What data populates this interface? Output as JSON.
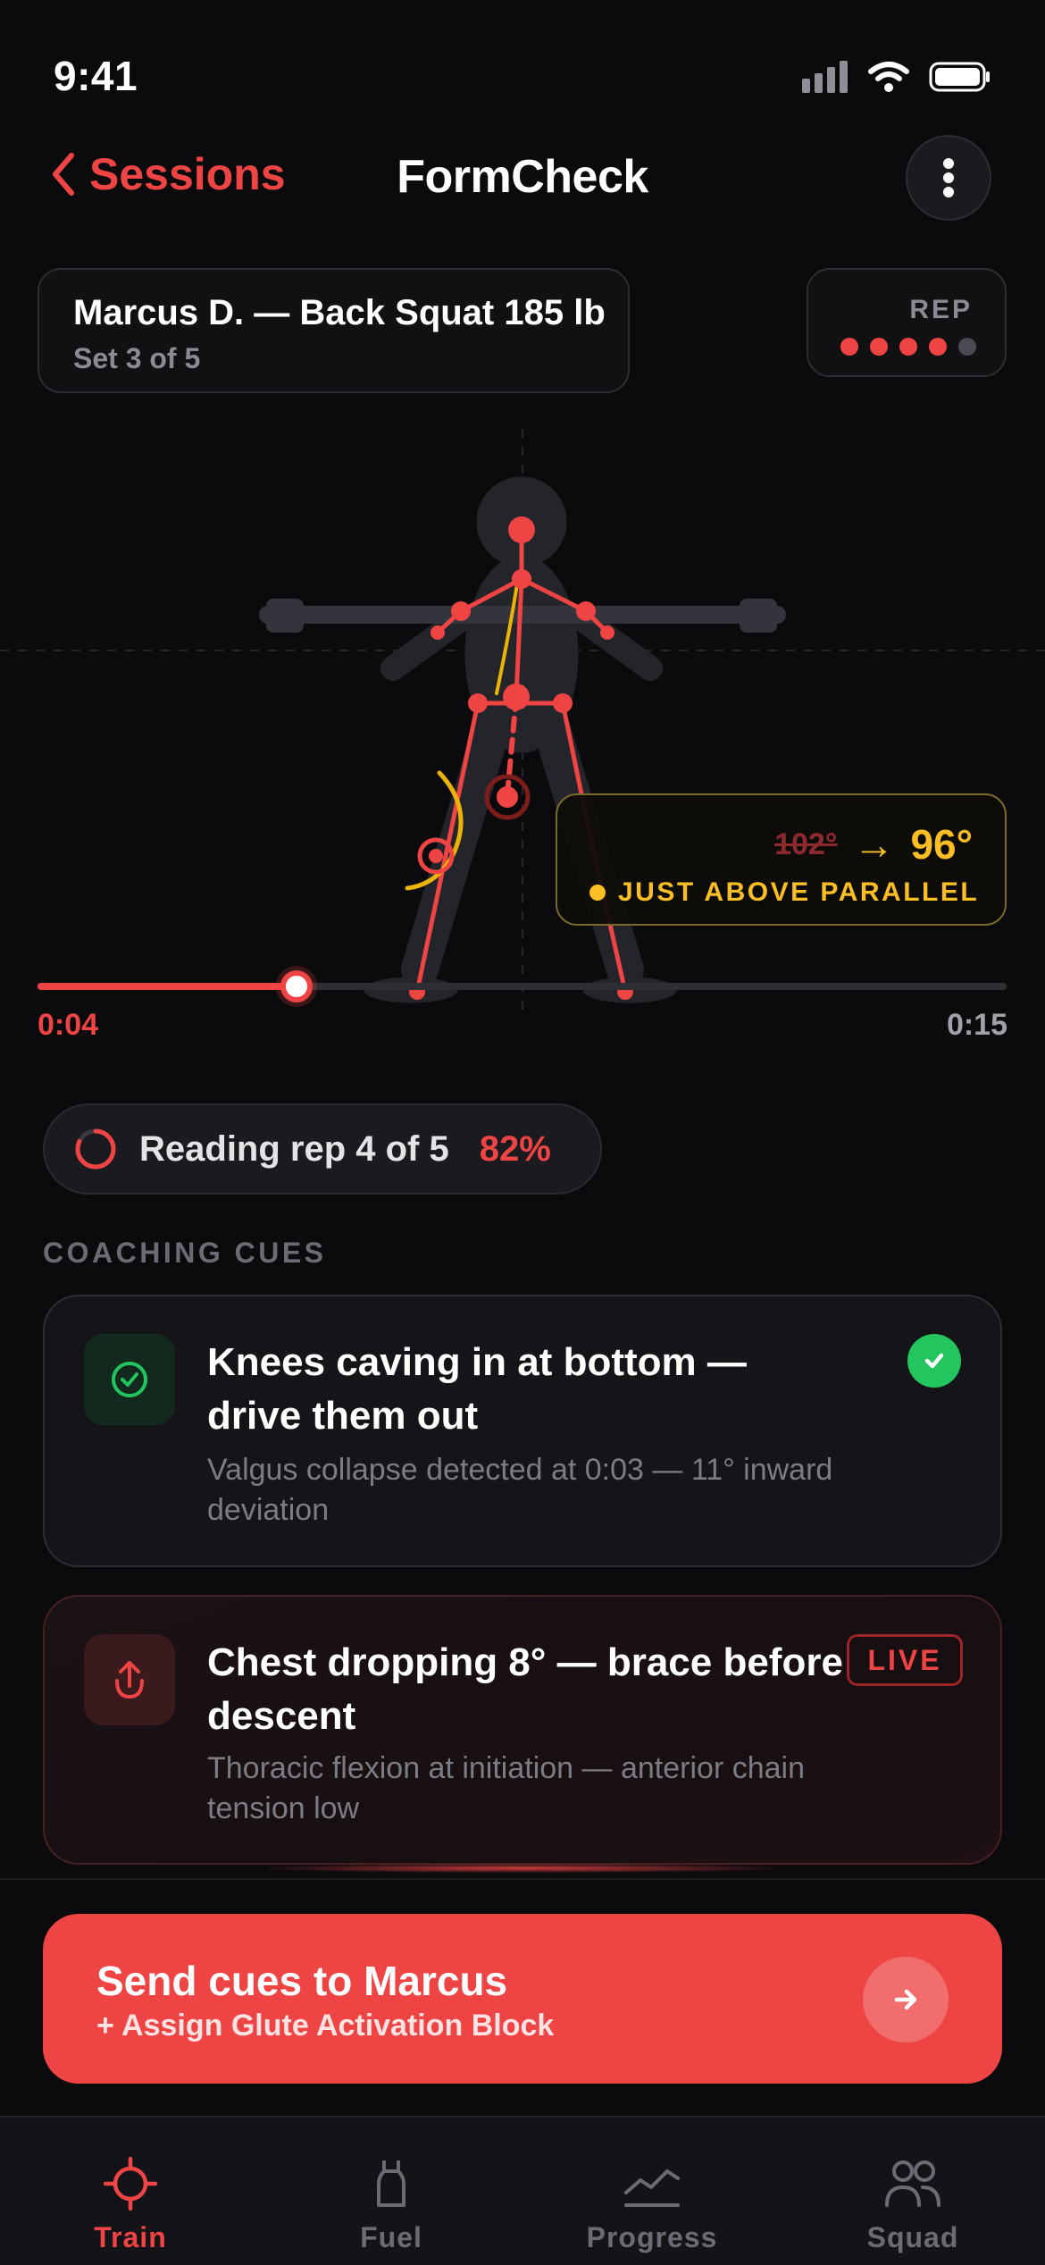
{
  "status_bar": {
    "time": "9:41"
  },
  "nav": {
    "back_label": "Sessions",
    "title": "FormCheck"
  },
  "session": {
    "athlete_lift": "Marcus D. — Back Squat 185 lb",
    "set_label": "Set 3 of 5"
  },
  "rep_indicator": {
    "label": "REP",
    "total": 5,
    "completed": 4
  },
  "angle": {
    "previous": "102°",
    "current": "96°",
    "status": "JUST ABOVE PARALLEL"
  },
  "timeline": {
    "current": "0:04",
    "duration": "0:15",
    "progress": 0.267
  },
  "analysis": {
    "text": "Reading rep 4 of 5",
    "percent": "82%"
  },
  "coaching": {
    "section_label": "COACHING CUES",
    "cues": [
      {
        "title": "Knees caving in at bottom — drive them out",
        "detail": "Valgus collapse detected at 0:03 — 11° inward deviation",
        "state": "resolved"
      },
      {
        "title": "Chest dropping 8° — brace before descent",
        "detail": "Thoracic flexion at initiation — anterior chain tension low",
        "badge": "LIVE"
      }
    ]
  },
  "cta": {
    "title": "Send cues to Marcus",
    "subtitle": "+ Assign Glute Activation Block"
  },
  "tabs": [
    {
      "label": "Train",
      "icon": "crosshair-icon",
      "active": true
    },
    {
      "label": "Fuel",
      "icon": "bottle-icon",
      "active": false
    },
    {
      "label": "Progress",
      "icon": "chart-icon",
      "active": false
    },
    {
      "label": "Squad",
      "icon": "people-icon",
      "active": false
    }
  ],
  "colors": {
    "accent": "#ef4444",
    "warning": "#fbbf24",
    "success": "#22c55e",
    "background": "#0b0b0e"
  }
}
